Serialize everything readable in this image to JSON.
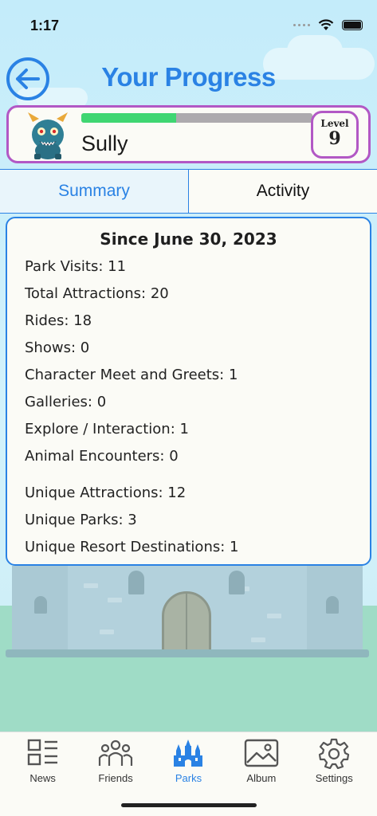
{
  "status_bar": {
    "time": "1:17"
  },
  "header": {
    "title": "Your Progress"
  },
  "profile": {
    "character_name": "Sully",
    "level_label": "Level",
    "level_number": "9",
    "progress_fraction": 0.41
  },
  "tabs": [
    {
      "label": "Summary",
      "active": true
    },
    {
      "label": "Activity",
      "active": false
    }
  ],
  "summary": {
    "heading": "Since June 30, 2023",
    "stats_group_1": [
      "Park Visits: 11",
      "Total Attractions: 20",
      "Rides: 18",
      "Shows: 0",
      "Character Meet and Greets: 1",
      "Galleries: 0",
      "Explore / Interaction: 1",
      "Animal Encounters: 0"
    ],
    "stats_group_2": [
      "Unique Attractions: 12",
      "Unique Parks: 3",
      "Unique Resort Destinations: 1"
    ]
  },
  "bottom_nav": [
    {
      "label": "News",
      "icon": "news-icon",
      "active": false
    },
    {
      "label": "Friends",
      "icon": "friends-icon",
      "active": false
    },
    {
      "label": "Parks",
      "icon": "castle-icon",
      "active": true
    },
    {
      "label": "Album",
      "icon": "photo-album-icon",
      "active": false
    },
    {
      "label": "Settings",
      "icon": "gear-icon",
      "active": false
    }
  ],
  "colors": {
    "accent": "#2a82e4",
    "card_border": "#b258c5",
    "progress_fill": "#3fd672"
  }
}
